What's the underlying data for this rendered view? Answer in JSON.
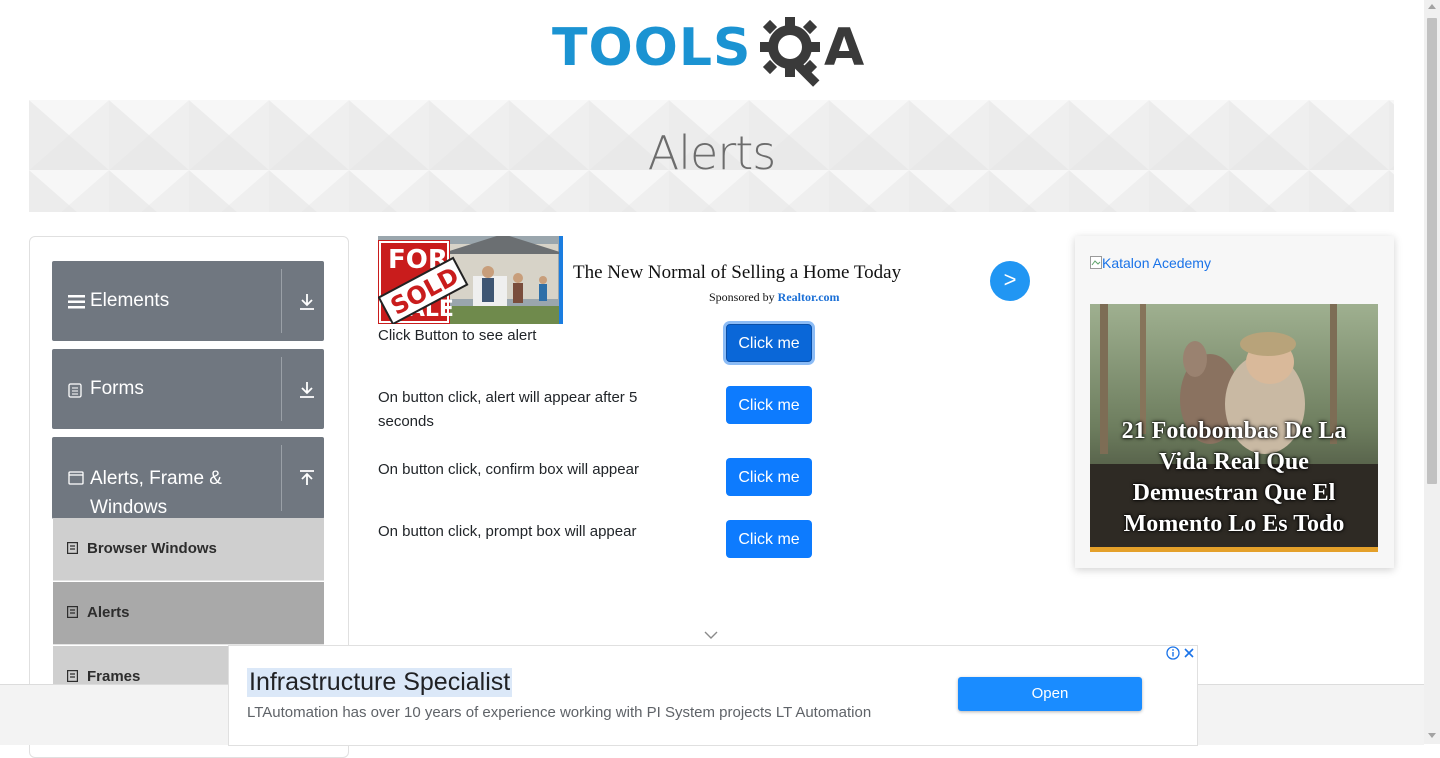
{
  "logo": {
    "tools": "TOOLS",
    "a": "A"
  },
  "banner": {
    "title": "Alerts"
  },
  "sidebar": {
    "groups": [
      {
        "label": "Elements",
        "icon": "hamburger-icon",
        "state": "collapsed"
      },
      {
        "label": "Forms",
        "icon": "document-icon",
        "state": "collapsed"
      },
      {
        "label": "Alerts, Frame & Windows",
        "icon": "window-icon",
        "state": "expanded"
      }
    ],
    "items": [
      {
        "label": "Browser Windows",
        "active": false
      },
      {
        "label": "Alerts",
        "active": true
      },
      {
        "label": "Frames",
        "active": false
      }
    ]
  },
  "top_ad": {
    "headline": "The New Normal of Selling a Home Today",
    "sponsored_prefix": "Sponsored by",
    "sponsor": "Realtor.com",
    "sign_text_top": "FOR",
    "sign_text_sold": "SOLD",
    "sign_text_bottom": "SALE",
    "arrow": ">"
  },
  "alerts": {
    "rows": [
      {
        "text": "Click Button to see alert",
        "button": "Click me"
      },
      {
        "text": "On button click, alert will appear after 5 seconds",
        "button": "Click me"
      },
      {
        "text": "On button click, confirm box will appear",
        "button": "Click me"
      },
      {
        "text": "On button click, prompt box will appear",
        "button": "Click me"
      }
    ]
  },
  "right_ad": {
    "broken_image_alt": "Katalon Acedemy",
    "caption": "21 Fotobombas De La Vida Real Que Demuestran Que El Momento Lo Es Todo"
  },
  "bottom_ad": {
    "title": "Infrastructure Specialist",
    "subtitle": "LTAutomation has over 10 years of experience working with PI System projects LT Automation",
    "button": "Open"
  },
  "colors": {
    "brand_blue": "#1b93d2",
    "button_blue": "#0d7bfe",
    "sidebar_header": "#707780",
    "sub_item_bg": "#cfcfcf",
    "sub_item_active_bg": "#a9a9a9"
  }
}
